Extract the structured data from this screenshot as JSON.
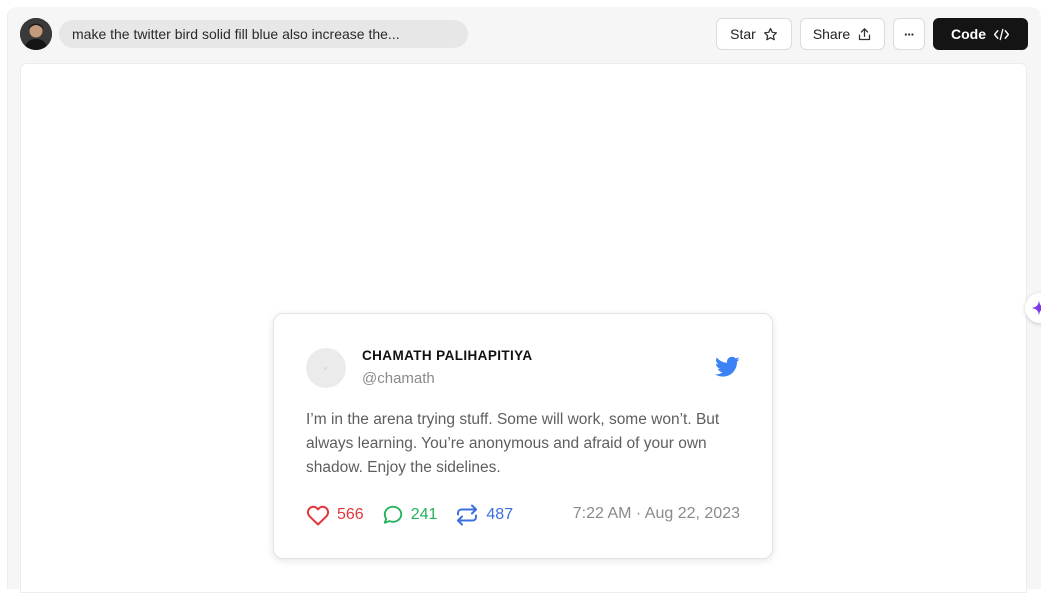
{
  "topbar": {
    "prompt_text": "make the twitter bird solid fill blue also increase the...",
    "star_label": "Star",
    "share_label": "Share",
    "more_label": "···",
    "code_label": "Code"
  },
  "tweet": {
    "name": "CHAMATH PALIHAPITIYA",
    "handle": "@chamath",
    "text": "I’m in the arena trying stuff. Some will work, some won’t. But always learning. You’re anonymous and afraid of your own shadow. Enjoy the sidelines.",
    "likes": "566",
    "replies": "241",
    "retweets": "487",
    "timestamp": "7:22 AM · Aug 22, 2023"
  },
  "colors": {
    "twitter_blue": "#3b82f6",
    "like_red": "#e0373c",
    "reply_green": "#22b35a",
    "retweet_blue": "#3b6fe0",
    "code_button_bg": "#141414",
    "spark_purple": "#7c3aed"
  },
  "icons": [
    "user-avatar",
    "star-icon",
    "share-icon",
    "more-icon",
    "code-icon",
    "twitter-bird-icon",
    "heart-icon",
    "comment-icon",
    "retweet-icon",
    "sparkle-icon"
  ]
}
